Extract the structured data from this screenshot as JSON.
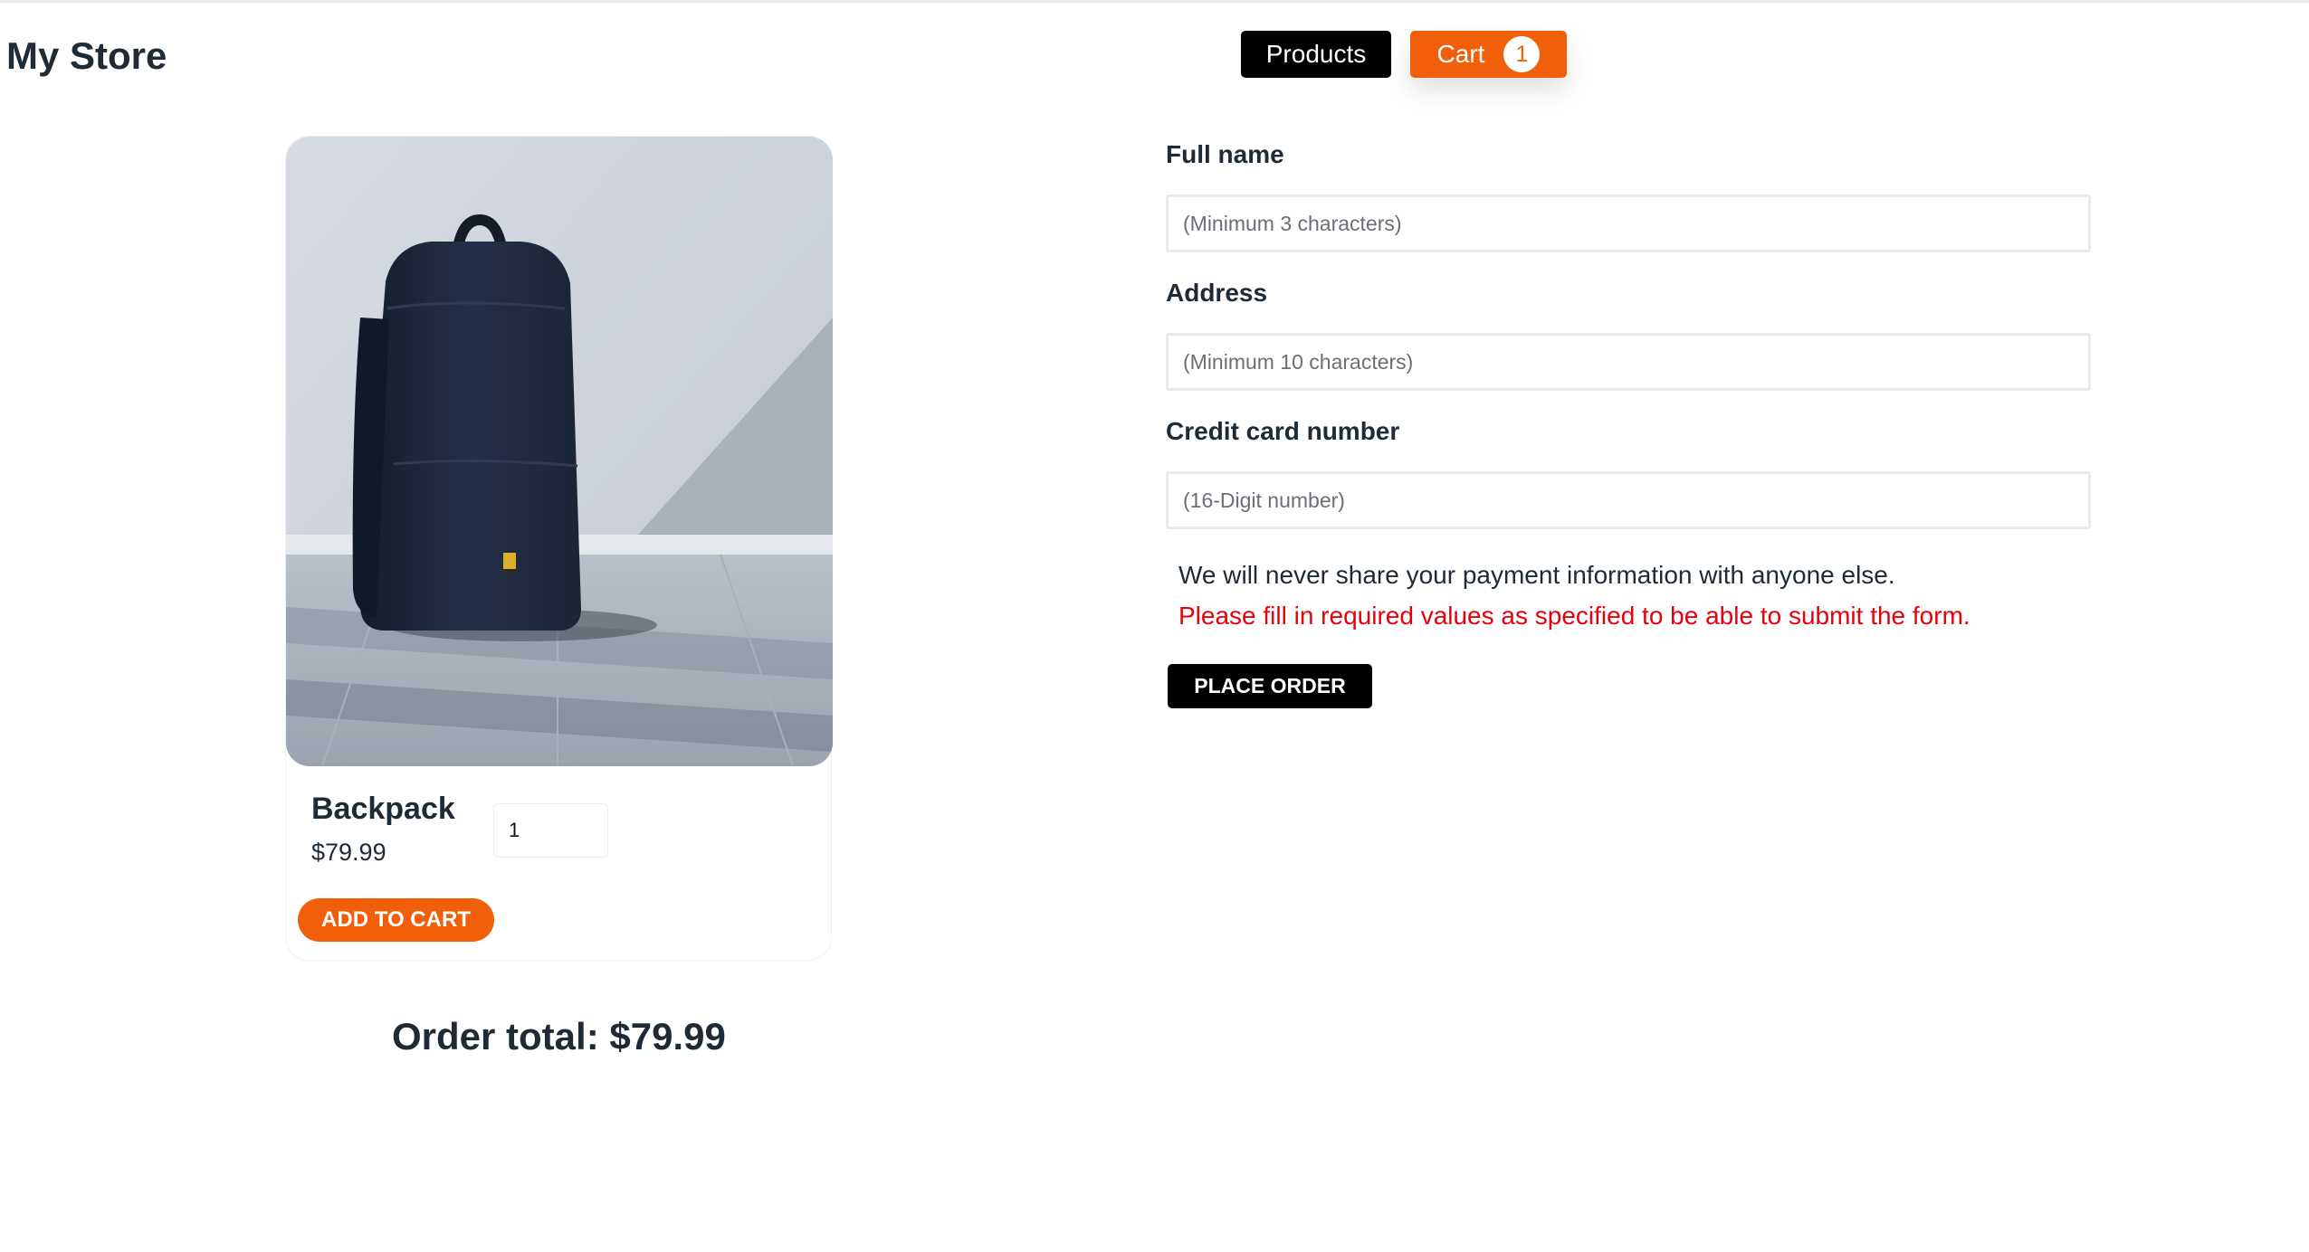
{
  "store": {
    "title": "My Store"
  },
  "nav": {
    "products_label": "Products",
    "cart_label": "Cart",
    "cart_count": "1"
  },
  "product": {
    "name": "Backpack",
    "price": "$79.99",
    "quantity": "1",
    "add_to_cart_label": "ADD TO CART",
    "image_icon": "backpack-photo"
  },
  "order": {
    "total_text": "Order total: $79.99"
  },
  "form": {
    "full_name_label": "Full name",
    "full_name_placeholder": "(Minimum 3 characters)",
    "address_label": "Address",
    "address_placeholder": "(Minimum 10 characters)",
    "card_label": "Credit card number",
    "card_placeholder": "(16-Digit number)",
    "privacy_note": "We will never share your payment information with anyone else.",
    "error_message": "Please fill in required values as specified to be able to submit the form.",
    "submit_label": "PLACE ORDER"
  },
  "colors": {
    "accent": "#f15f0a",
    "error": "#e8000b",
    "dark": "#000000"
  }
}
